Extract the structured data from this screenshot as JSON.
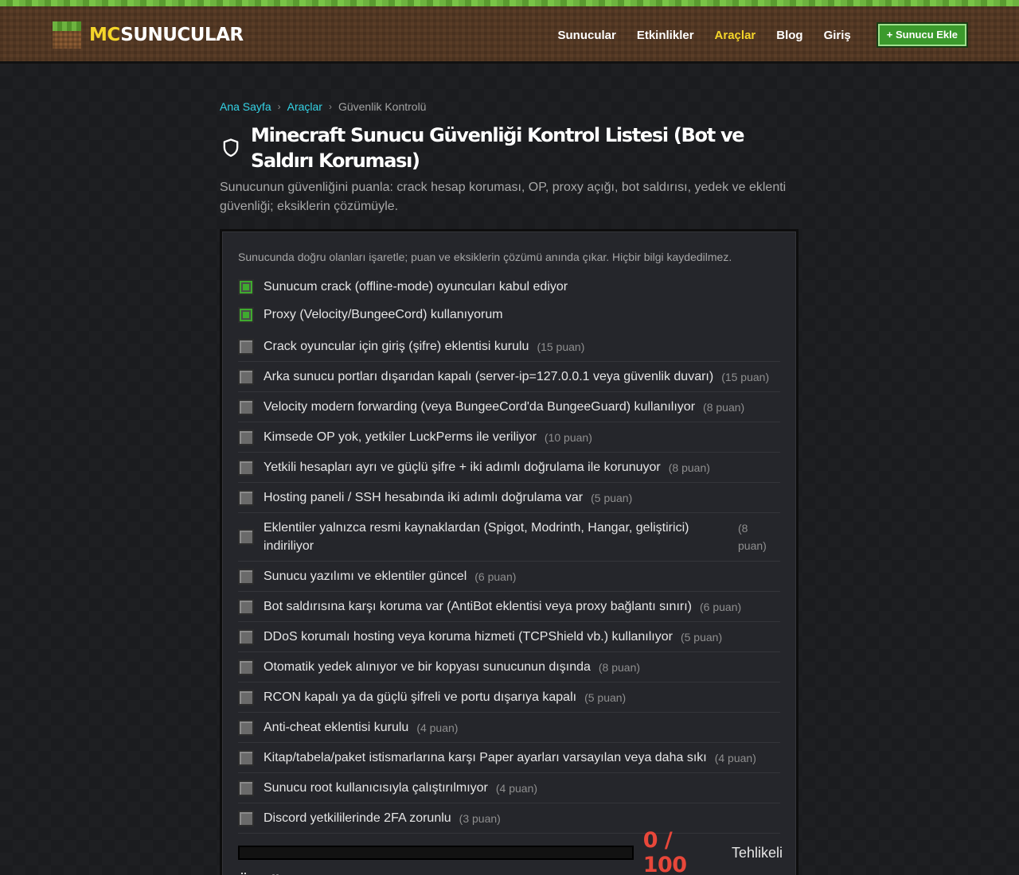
{
  "site": {
    "logo_mc": "MC",
    "logo_rest": "SUNUCULAR"
  },
  "nav": {
    "items": [
      {
        "label": "Sunucular"
      },
      {
        "label": "Etkinlikler"
      },
      {
        "label": "Araçlar",
        "active": true
      },
      {
        "label": "Blog"
      },
      {
        "label": "Giriş"
      }
    ],
    "add_button": "+ Sunucu Ekle"
  },
  "breadcrumb": {
    "home": "Ana Sayfa",
    "sep": "›",
    "tools": "Araçlar",
    "current": "Güvenlik Kontrolü"
  },
  "page": {
    "title": "Minecraft Sunucu Güvenliği Kontrol Listesi (Bot ve Saldırı Koruması)",
    "description": "Sunucunun güvenliğini puanla: crack hesap koruması, OP, proxy açığı, bot saldırısı, yedek ve eklenti güvenliği; eksiklerin çözümüyle."
  },
  "card": {
    "note": "Sunucunda doğru olanları işaretle; puan ve eksiklerin çözümü anında çıkar. Hiçbir bilgi kaydedilmez.",
    "top_questions": [
      {
        "text": "Sunucum crack (offline-mode) oyuncuları kabul ediyor",
        "checked": true
      },
      {
        "text": "Proxy (Velocity/BungeeCord) kullanıyorum",
        "checked": true
      }
    ],
    "questions": [
      {
        "text": "Crack oyuncular için giriş (şifre) eklentisi kurulu",
        "points": "(15 puan)"
      },
      {
        "text": "Arka sunucu portları dışarıdan kapalı (server-ip=127.0.0.1 veya güvenlik duvarı)",
        "points": "(15 puan)"
      },
      {
        "text": "Velocity modern forwarding (veya BungeeCord'da BungeeGuard) kullanılıyor",
        "points": "(8 puan)"
      },
      {
        "text": "Kimsede OP yok, yetkiler LuckPerms ile veriliyor",
        "points": "(10 puan)"
      },
      {
        "text": "Yetkili hesapları ayrı ve güçlü şifre + iki adımlı doğrulama ile korunuyor",
        "points": "(8 puan)"
      },
      {
        "text": "Hosting paneli / SSH hesabında iki adımlı doğrulama var",
        "points": "(5 puan)"
      },
      {
        "text": "Eklentiler yalnızca resmi kaynaklardan (Spigot, Modrinth, Hangar, geliştirici) indiriliyor",
        "points": "(8 puan)",
        "wrap": true
      },
      {
        "text": "Sunucu yazılımı ve eklentiler güncel",
        "points": "(6 puan)"
      },
      {
        "text": "Bot saldırısına karşı koruma var (AntiBot eklentisi veya proxy bağlantı sınırı)",
        "points": "(6 puan)"
      },
      {
        "text": "DDoS korumalı hosting veya koruma hizmeti (TCPShield vb.) kullanılıyor",
        "points": "(5 puan)"
      },
      {
        "text": "Otomatik yedek alınıyor ve bir kopyası sunucunun dışında",
        "points": "(8 puan)"
      },
      {
        "text": "RCON kapalı ya da güçlü şifreli ve portu dışarıya kapalı",
        "points": "(5 puan)"
      },
      {
        "text": "Anti-cheat eklentisi kurulu",
        "points": "(4 puan)"
      },
      {
        "text": "Kitap/tabela/paket istismarlarına karşı Paper ayarları varsayılan veya daha sıkı",
        "points": "(4 puan)"
      },
      {
        "text": "Sunucu root kullanıcısıyla çalıştırılmıyor",
        "points": "(4 puan)"
      },
      {
        "text": "Discord yetkililerinde 2FA zorunlu",
        "points": "(3 puan)"
      }
    ]
  },
  "score": {
    "display": "0 / 100",
    "label": "Tehlikeli",
    "value": 0,
    "max": 100,
    "color": "#e8473a"
  },
  "icons": {
    "title": "shield-icon"
  }
}
